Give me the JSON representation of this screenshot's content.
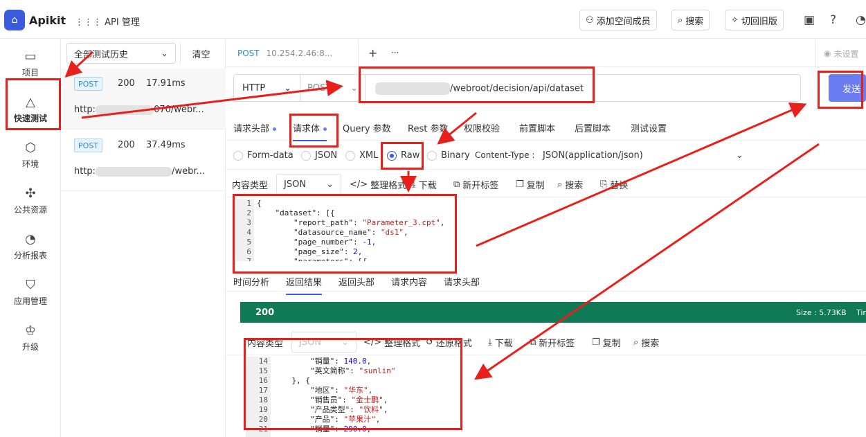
{
  "topbar": {
    "logo_glyph": "⌂",
    "brand": "Apikit",
    "menu": "API 管理",
    "add_member": "添加空间成员",
    "search": "搜索",
    "back_old": "切回旧版"
  },
  "nav": [
    {
      "label": "项目",
      "icon": "folder-icon"
    },
    {
      "label": "快速测试",
      "icon": "rocket-icon"
    },
    {
      "label": "环境",
      "icon": "cube-icon"
    },
    {
      "label": "公共资源",
      "icon": "puzzle-icon"
    },
    {
      "label": "分析报表",
      "icon": "pie-chart-icon"
    },
    {
      "label": "应用管理",
      "icon": "shield-icon"
    },
    {
      "label": "升级",
      "icon": "crown-icon"
    }
  ],
  "history": {
    "filter": "全部测试历史",
    "clear": "清空",
    "items": [
      {
        "method": "POST",
        "code": "200",
        "time": "17.91ms",
        "url_prefix": "http:",
        "url_suffix": "070/webr..."
      },
      {
        "method": "POST",
        "code": "200",
        "time": "37.49ms",
        "url_prefix": "http:",
        "url_suffix": "/webr..."
      }
    ]
  },
  "request_tab": {
    "method": "POST",
    "url": "10.254.2.46:8...",
    "add": "+",
    "more": "···"
  },
  "settings_tab": "未设置",
  "url_bar": {
    "protocol": "HTTP",
    "method": "POST",
    "path": "/webroot/decision/api/dataset",
    "send": "发送"
  },
  "sub_tabs": [
    "请求头部",
    "请求体",
    "Query 参数",
    "Rest 参数",
    "权限校验",
    "前置脚本",
    "后置脚本",
    "测试设置"
  ],
  "body_types": [
    "Form-data",
    "JSON",
    "XML",
    "Raw",
    "Binary"
  ],
  "content_type_label": "Content-Type :",
  "content_type_value": "JSON(application/json)",
  "content_kind_label": "内容类型",
  "content_kind_value": "JSON",
  "tools": {
    "format": "整理格式",
    "download": "下载",
    "new_tab": "新开标签",
    "copy": "复制",
    "search": "搜索",
    "replace": "替换",
    "restore": "还原格式"
  },
  "request_body_lines": [
    "1",
    "2",
    "3",
    "4",
    "5",
    "6",
    "7"
  ],
  "response_tabs": [
    "时间分析",
    "返回结果",
    "返回头部",
    "请求内容",
    "请求头部"
  ],
  "status": {
    "code": "200",
    "size": "Size : 5.73KB",
    "time": "Tir"
  },
  "response_lines": [
    "14",
    "15",
    "16",
    "17",
    "18",
    "19",
    "20",
    "21"
  ]
}
